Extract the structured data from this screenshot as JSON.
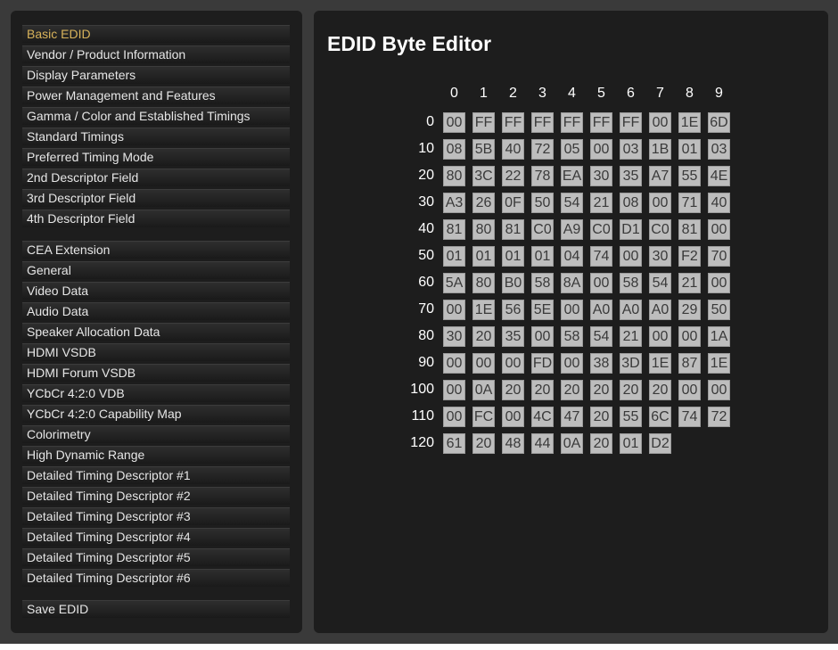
{
  "sidebar": {
    "groups": [
      [
        "Basic EDID",
        "Vendor / Product Information",
        "Display Parameters",
        "Power Management and Features",
        "Gamma / Color and Established Timings",
        "Standard Timings",
        "Preferred Timing Mode",
        "2nd Descriptor Field",
        "3rd Descriptor Field",
        "4th Descriptor Field"
      ],
      [
        "CEA Extension",
        "General",
        "Video Data",
        "Audio Data",
        "Speaker Allocation Data",
        "HDMI VSDB",
        "HDMI Forum VSDB",
        "YCbCr 4:2:0 VDB",
        "YCbCr 4:2:0 Capability Map",
        "Colorimetry",
        "High Dynamic Range",
        "Detailed Timing Descriptor #1",
        "Detailed Timing Descriptor #2",
        "Detailed Timing Descriptor #3",
        "Detailed Timing Descriptor #4",
        "Detailed Timing Descriptor #5",
        "Detailed Timing Descriptor #6"
      ],
      [
        "Save EDID"
      ]
    ],
    "active": "Basic EDID"
  },
  "editor": {
    "title": "EDID Byte Editor",
    "col_headers": [
      "0",
      "1",
      "2",
      "3",
      "4",
      "5",
      "6",
      "7",
      "8",
      "9"
    ],
    "row_headers": [
      "0",
      "10",
      "20",
      "30",
      "40",
      "50",
      "60",
      "70",
      "80",
      "90",
      "100",
      "110",
      "120"
    ],
    "rows": [
      [
        "00",
        "FF",
        "FF",
        "FF",
        "FF",
        "FF",
        "FF",
        "00",
        "1E",
        "6D"
      ],
      [
        "08",
        "5B",
        "40",
        "72",
        "05",
        "00",
        "03",
        "1B",
        "01",
        "03"
      ],
      [
        "80",
        "3C",
        "22",
        "78",
        "EA",
        "30",
        "35",
        "A7",
        "55",
        "4E"
      ],
      [
        "A3",
        "26",
        "0F",
        "50",
        "54",
        "21",
        "08",
        "00",
        "71",
        "40"
      ],
      [
        "81",
        "80",
        "81",
        "C0",
        "A9",
        "C0",
        "D1",
        "C0",
        "81",
        "00"
      ],
      [
        "01",
        "01",
        "01",
        "01",
        "04",
        "74",
        "00",
        "30",
        "F2",
        "70"
      ],
      [
        "5A",
        "80",
        "B0",
        "58",
        "8A",
        "00",
        "58",
        "54",
        "21",
        "00"
      ],
      [
        "00",
        "1E",
        "56",
        "5E",
        "00",
        "A0",
        "A0",
        "A0",
        "29",
        "50"
      ],
      [
        "30",
        "20",
        "35",
        "00",
        "58",
        "54",
        "21",
        "00",
        "00",
        "1A"
      ],
      [
        "00",
        "00",
        "00",
        "FD",
        "00",
        "38",
        "3D",
        "1E",
        "87",
        "1E"
      ],
      [
        "00",
        "0A",
        "20",
        "20",
        "20",
        "20",
        "20",
        "20",
        "00",
        "00"
      ],
      [
        "00",
        "FC",
        "00",
        "4C",
        "47",
        "20",
        "55",
        "6C",
        "74",
        "72"
      ],
      [
        "61",
        "20",
        "48",
        "44",
        "0A",
        "20",
        "01",
        "D2"
      ]
    ]
  }
}
